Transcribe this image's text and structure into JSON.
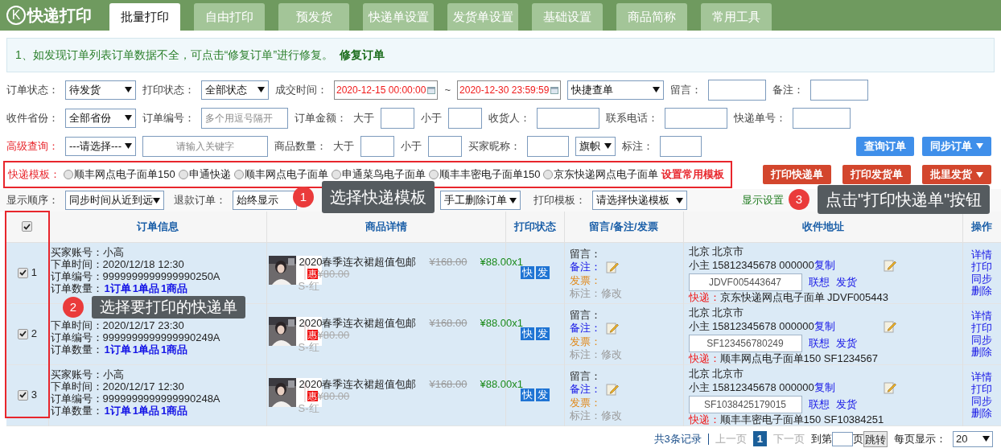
{
  "app": {
    "logo_letter": "K",
    "title": "快递打印"
  },
  "tabs": [
    {
      "label": "批量打印",
      "selected": true
    },
    {
      "label": "自由打印",
      "selected": false
    },
    {
      "label": "预发货",
      "selected": false
    },
    {
      "label": "快递单设置",
      "selected": false
    },
    {
      "label": "发货单设置",
      "selected": false
    },
    {
      "label": "基础设置",
      "selected": false
    },
    {
      "label": "商品简称",
      "selected": false
    },
    {
      "label": "常用工具",
      "selected": false
    }
  ],
  "notice": {
    "text": "1、如发现订单列表订单数据不全，可点击“修复订单”进行修复。",
    "link": "修复订单"
  },
  "filter_rows": [
    {
      "items": [
        {
          "kind": "label",
          "text": "订单状态："
        },
        {
          "kind": "select",
          "value": "待发货"
        },
        {
          "kind": "label",
          "text": "打印状态："
        },
        {
          "kind": "select",
          "value": "全部状态"
        },
        {
          "kind": "label",
          "text": "成交时间："
        },
        {
          "kind": "date",
          "value": "2020-12-15 00:00:00"
        },
        {
          "kind": "label",
          "text": "~"
        },
        {
          "kind": "date",
          "value": "2020-12-30 23:59:59"
        },
        {
          "kind": "select",
          "value": "快捷查单"
        },
        {
          "kind": "label",
          "text": "留言："
        },
        {
          "kind": "input"
        },
        {
          "kind": "label",
          "text": "备注："
        },
        {
          "kind": "input"
        }
      ]
    },
    {
      "items": [
        {
          "kind": "label",
          "text": "收件省份："
        },
        {
          "kind": "select",
          "value": "全部省份"
        },
        {
          "kind": "label",
          "text": "订单编号："
        },
        {
          "kind": "input",
          "placeholder": "多个用逗号隔开"
        },
        {
          "kind": "label",
          "text": "订单金额："
        },
        {
          "kind": "label",
          "text": "大于"
        },
        {
          "kind": "input"
        },
        {
          "kind": "label",
          "text": "小于"
        },
        {
          "kind": "input"
        },
        {
          "kind": "label",
          "text": "收货人："
        },
        {
          "kind": "input"
        },
        {
          "kind": "label",
          "text": "联系电话："
        },
        {
          "kind": "input"
        },
        {
          "kind": "label",
          "text": "快递单号："
        },
        {
          "kind": "input"
        }
      ]
    },
    {
      "items": [
        {
          "kind": "alert-label",
          "text": "高级查询："
        },
        {
          "kind": "select",
          "value": "---请选择---"
        },
        {
          "kind": "input",
          "placeholder": "请输入关键字"
        },
        {
          "kind": "label",
          "text": "商品数量："
        },
        {
          "kind": "label",
          "text": "大于"
        },
        {
          "kind": "input"
        },
        {
          "kind": "label",
          "text": "小于"
        },
        {
          "kind": "input"
        },
        {
          "kind": "label",
          "text": "买家昵称："
        },
        {
          "kind": "input"
        },
        {
          "kind": "select",
          "value": "旗帜"
        },
        {
          "kind": "label",
          "text": "标注："
        },
        {
          "kind": "input"
        }
      ],
      "buttons": [
        {
          "label": "查询订单",
          "color": "#3f8fea",
          "dropdown": false
        },
        {
          "label": "同步订单",
          "color": "#3f8fea",
          "dropdown": true
        }
      ]
    }
  ],
  "template_row": {
    "label": "快递模板：",
    "options": [
      {
        "label": "顺丰网点电子面单150",
        "selected": false
      },
      {
        "label": "申通快递",
        "selected": false
      },
      {
        "label": "顺丰网点电子面单",
        "selected": false
      },
      {
        "label": "申通菜鸟电子面单",
        "selected": false
      },
      {
        "label": "顺丰丰密电子面单150",
        "selected": false
      },
      {
        "label": "京东快递网点电子面单",
        "selected": false
      }
    ],
    "link": "设置常用模板",
    "buttons": [
      {
        "label": "打印快递单",
        "color": "#d3462d",
        "dropdown": false
      },
      {
        "label": "打印发货单",
        "color": "#d3462d",
        "dropdown": false
      },
      {
        "label": "批里发货",
        "color": "#d3462d",
        "dropdown": true
      }
    ]
  },
  "display_row": {
    "items": [
      {
        "kind": "label",
        "text": "显示顺序："
      },
      {
        "kind": "select",
        "value": "同步时间从近到远"
      },
      {
        "kind": "label",
        "text": "退款订单："
      },
      {
        "kind": "field",
        "value": "始终显示"
      },
      {
        "kind": "select",
        "value": "手工删除订单"
      },
      {
        "kind": "label",
        "text": "打印模板："
      },
      {
        "kind": "select",
        "value": "请选择快递模板"
      }
    ],
    "link": "显示设置"
  },
  "table": {
    "all_checked": true,
    "columns": [
      "订单信息",
      "商品详情",
      "打印状态",
      "留言/备注/发票",
      "收件地址",
      "操作"
    ],
    "rows": [
      {
        "checked": true,
        "number": "1",
        "order_lines": [
          {
            "label": "买家账号：",
            "value": "小高"
          },
          {
            "label": "下单时间：",
            "value": "2020/12/18 12:30"
          },
          {
            "label": "订单编号：",
            "value": "9999999999999990250A"
          }
        ],
        "count_label": "订单数量：",
        "counts": [
          "1订单",
          "1单品",
          "1商品"
        ],
        "product": {
          "title": "2020春季连衣裙超值包邮",
          "original_price": "¥168.00",
          "price": "¥88.00x1",
          "badge": "惠",
          "discount": "¥80.00",
          "sku": "S-红"
        },
        "print_status": [
          "快",
          "发"
        ],
        "memo": {
          "message": "留言：",
          "note": "备注：",
          "invoice": "发票：",
          "mark": "标注：",
          "edit": "修改"
        },
        "address": {
          "line": "北京 北京市",
          "contact": "小主 15812345678 000000",
          "copy": "复制",
          "tracking": "JDVF005443647",
          "associate": "联想",
          "ship": "发货",
          "express_label": "快递：",
          "express": "京东快递网点电子面单 JDVF005443"
        },
        "actions": [
          "详情",
          "打印",
          "同步",
          "删除"
        ]
      },
      {
        "checked": true,
        "number": "2",
        "order_lines": [
          {
            "label": "下单时间：",
            "value": "2020/12/17 23:30"
          },
          {
            "label": "订单编号：",
            "value": "9999999999999990249A"
          }
        ],
        "count_label": "订单数量：",
        "counts": [
          "1订单",
          "1单品",
          "1商品"
        ],
        "product": {
          "title": "2020春季连衣裙超值包邮",
          "original_price": "¥168.00",
          "price": "¥88.00x1",
          "badge": "惠",
          "discount": "¥80.00",
          "sku": "S-红"
        },
        "print_status": [
          "快",
          "发"
        ],
        "memo": {
          "message": "留言：",
          "note": "备注：",
          "invoice": "发票：",
          "mark": "标注：",
          "edit": "修改"
        },
        "address": {
          "line": "北京 北京市",
          "contact": "小主 15812345678 000000",
          "copy": "复制",
          "tracking": "SF123456780249",
          "associate": "联想",
          "ship": "发货",
          "express_label": "快递：",
          "express": "顺丰网点电子面单150 SF1234567"
        },
        "actions": [
          "详情",
          "打印",
          "同步",
          "删除"
        ]
      },
      {
        "checked": true,
        "number": "3",
        "order_lines": [
          {
            "label": "买家账号：",
            "value": "小高"
          },
          {
            "label": "下单时间：",
            "value": "2020/12/17 12:30"
          },
          {
            "label": "订单编号：",
            "value": "9999999999999990248A"
          }
        ],
        "count_label": "订单数量：",
        "counts": [
          "1订单",
          "1单品",
          "1商品"
        ],
        "product": {
          "title": "2020春季连衣裙超值包邮",
          "original_price": "¥168.00",
          "price": "¥88.00x1",
          "badge": "惠",
          "discount": "¥80.00",
          "sku": "S-红"
        },
        "print_status": [
          "快",
          "发"
        ],
        "memo": {
          "message": "留言：",
          "note": "备注：",
          "invoice": "发票：",
          "mark": "标注：",
          "edit": "修改"
        },
        "address": {
          "line": "北京 北京市",
          "contact": "小主 15812345678 000000",
          "copy": "复制",
          "tracking": "SF1038425179015",
          "associate": "联想",
          "ship": "发货",
          "express_label": "快递：",
          "express": "顺丰丰密电子面单150 SF10384251"
        },
        "actions": [
          "详情",
          "打印",
          "同步",
          "删除"
        ]
      }
    ]
  },
  "pagination": {
    "total": "共3条记录",
    "prev": "上一页",
    "pages": [
      {
        "label": "1",
        "selected": true
      }
    ],
    "next": "下一页",
    "goto_label": "到第",
    "page_label": "页",
    "jump": "跳转",
    "per_page_label": "每页显示：",
    "per_page": "20"
  },
  "callouts": [
    {
      "number": "1",
      "text": "选择快递模板"
    },
    {
      "number": "2",
      "text": "选择要打印的快递单"
    },
    {
      "number": "3",
      "text": "点击\"打印快递单\"按钮"
    }
  ]
}
